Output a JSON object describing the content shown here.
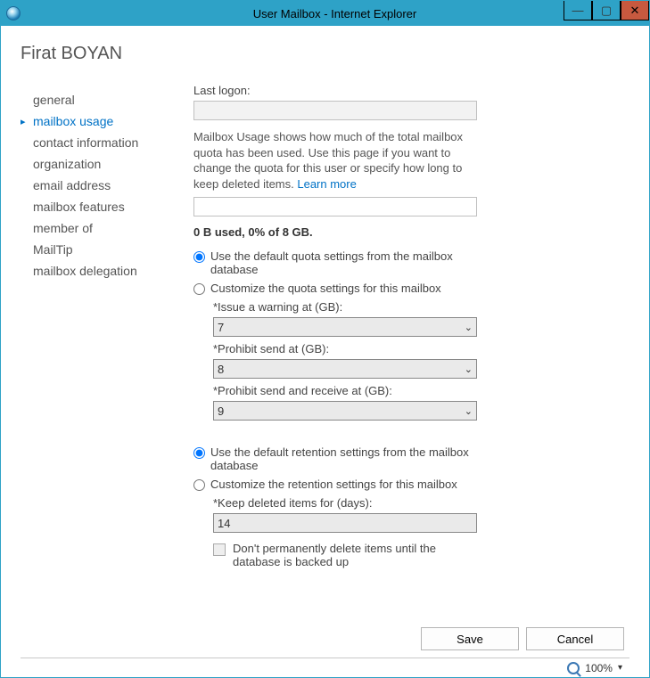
{
  "window": {
    "title": "User Mailbox - Internet Explorer"
  },
  "header": {
    "user_name": "Firat BOYAN"
  },
  "sidebar": {
    "items": [
      {
        "label": "general"
      },
      {
        "label": "mailbox usage",
        "active": true
      },
      {
        "label": "contact information"
      },
      {
        "label": "organization"
      },
      {
        "label": "email address"
      },
      {
        "label": "mailbox features"
      },
      {
        "label": "member of"
      },
      {
        "label": "MailTip"
      },
      {
        "label": "mailbox delegation"
      }
    ]
  },
  "main": {
    "last_logon_label": "Last logon:",
    "last_logon_value": "",
    "description": "Mailbox Usage shows how much of the total mailbox quota has been used. Use this page if you want to change the quota for this user or specify how long to keep deleted items.",
    "learn_more": "Learn more",
    "usage_summary": "0 B used, 0% of 8 GB.",
    "quota": {
      "default_label": "Use the default quota settings from the mailbox database",
      "custom_label": "Customize the quota settings for this mailbox",
      "warning_label": "*Issue a warning at (GB):",
      "warning_value": "7",
      "prohibit_send_label": "*Prohibit send at (GB):",
      "prohibit_send_value": "8",
      "prohibit_sr_label": "*Prohibit send and receive at (GB):",
      "prohibit_sr_value": "9"
    },
    "retention": {
      "default_label": "Use the default retention settings from the mailbox database",
      "custom_label": "Customize the retention settings for this mailbox",
      "keep_label": "*Keep deleted items for (days):",
      "keep_value": "14",
      "dont_delete_label": "Don't permanently delete items until the database is backed up"
    }
  },
  "footer": {
    "save": "Save",
    "cancel": "Cancel"
  },
  "status": {
    "zoom": "100%"
  }
}
